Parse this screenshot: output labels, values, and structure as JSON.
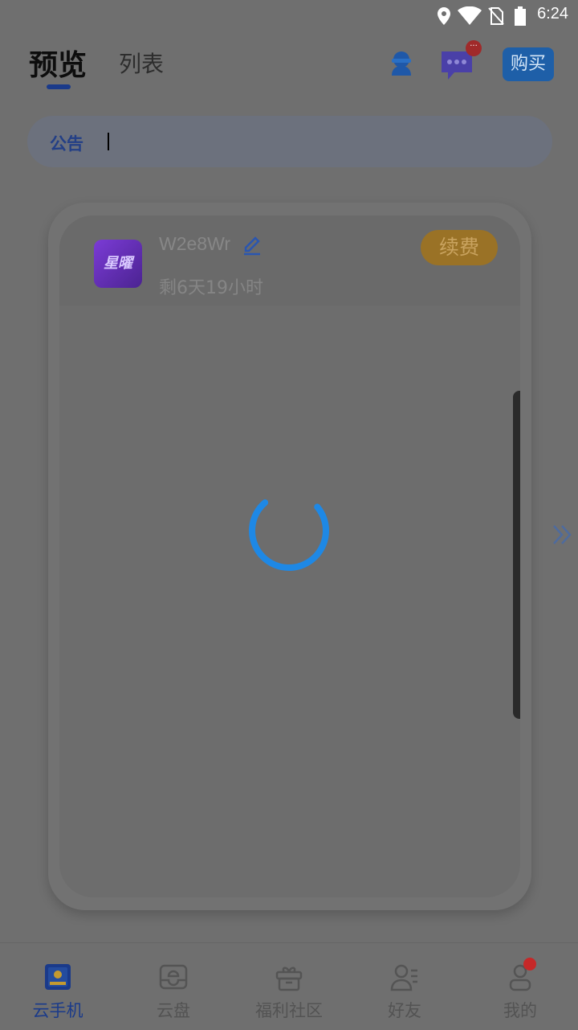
{
  "status_bar": {
    "time": "6:24",
    "icons": [
      "location-icon",
      "wifi-icon",
      "no-sim-icon",
      "battery-icon"
    ]
  },
  "header": {
    "tabs": [
      {
        "label": "预览",
        "active": true
      },
      {
        "label": "列表",
        "active": false
      }
    ],
    "icons": [
      "customer-service-icon",
      "message-icon"
    ],
    "message_badge": "···",
    "buy_label": "购买"
  },
  "notice": {
    "label": "公告"
  },
  "device_card": {
    "app_icon_text": "星曜",
    "name": "W2e8Wr",
    "remaining": "剩6天19小时",
    "renew_label": "续费",
    "status": "loading"
  },
  "bottom_nav": {
    "items": [
      {
        "label": "云手机",
        "icon": "cloud-phone-icon",
        "active": true
      },
      {
        "label": "云盘",
        "icon": "cloud-disk-icon",
        "active": false
      },
      {
        "label": "福利社区",
        "icon": "gift-icon",
        "active": false
      },
      {
        "label": "好友",
        "icon": "friends-icon",
        "active": false
      },
      {
        "label": "我的",
        "icon": "profile-icon",
        "active": false,
        "badge": true
      }
    ]
  },
  "colors": {
    "accent": "#1a3a8a",
    "spinner": "#1e88e5",
    "renew": "#9a7226",
    "badge": "#c62828"
  }
}
